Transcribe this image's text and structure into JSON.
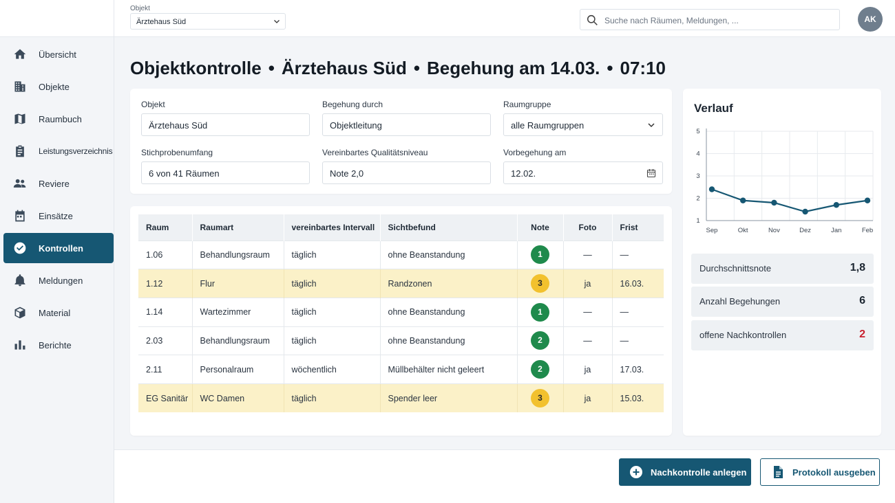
{
  "header": {
    "object_label": "Objekt",
    "object_value": "Ärztehaus Süd",
    "search_placeholder": "Suche nach Räumen, Meldungen, ...",
    "avatar_initials": "AK"
  },
  "sidebar": {
    "items": [
      {
        "label": "Übersicht",
        "icon": "home-icon"
      },
      {
        "label": "Objekte",
        "icon": "building-icon"
      },
      {
        "label": "Raumbuch",
        "icon": "map-icon"
      },
      {
        "label": "Leistungsverzeichnis",
        "icon": "clipboard-icon"
      },
      {
        "label": "Reviere",
        "icon": "people-icon"
      },
      {
        "label": "Einsätze",
        "icon": "calendar-icon"
      },
      {
        "label": "Kontrollen",
        "icon": "check-circle-icon",
        "active": true
      },
      {
        "label": "Meldungen",
        "icon": "bell-icon"
      },
      {
        "label": "Material",
        "icon": "box-icon"
      },
      {
        "label": "Berichte",
        "icon": "bar-chart-icon"
      }
    ]
  },
  "title": {
    "part1": "Objektkontrolle",
    "part2": "Ärztehaus Süd",
    "part3": "Begehung am 14.03.",
    "part4": "07:10",
    "separator": "•"
  },
  "filters": {
    "objekt": {
      "label": "Objekt",
      "value": "Ärztehaus Süd"
    },
    "begehung": {
      "label": "Begehung durch",
      "value": "Objektleitung"
    },
    "raumgruppe": {
      "label": "Raumgruppe",
      "value": "alle Raumgruppen"
    },
    "stichprobe": {
      "label": "Stichprobenumfang",
      "value": "6 von 41 Räumen"
    },
    "niveau": {
      "label": "Vereinbartes Qualitätsniveau",
      "value": "Note 2,0"
    },
    "vorbegehung": {
      "label": "Vorbegehung am",
      "value": "12.02."
    }
  },
  "table": {
    "headers": [
      "Raum",
      "Raumart",
      "vereinbartes Intervall",
      "Sichtbefund",
      "Note",
      "Foto",
      "Frist"
    ],
    "rows": [
      {
        "raum": "1.06",
        "raumart": "Behandlungsraum",
        "intervall": "täglich",
        "befund": "ohne Beanstandung",
        "note": "1",
        "foto": "—",
        "frist": "—",
        "highlight": false
      },
      {
        "raum": "1.12",
        "raumart": "Flur",
        "intervall": "täglich",
        "befund": "Randzonen",
        "note": "3",
        "foto": "ja",
        "frist": "16.03.",
        "highlight": true
      },
      {
        "raum": "1.14",
        "raumart": "Wartezimmer",
        "intervall": "täglich",
        "befund": "ohne Beanstandung",
        "note": "1",
        "foto": "—",
        "frist": "—",
        "highlight": false
      },
      {
        "raum": "2.03",
        "raumart": "Behandlungsraum",
        "intervall": "täglich",
        "befund": "ohne Beanstandung",
        "note": "2",
        "foto": "—",
        "frist": "—",
        "highlight": false
      },
      {
        "raum": "2.11",
        "raumart": "Personalraum",
        "intervall": "wöchentlich",
        "befund": "Müllbehälter nicht geleert",
        "note": "2",
        "foto": "ja",
        "frist": "17.03.",
        "highlight": false
      },
      {
        "raum": "EG Sanitär",
        "raumart": "WC Damen",
        "intervall": "täglich",
        "befund": "Spender leer",
        "note": "3",
        "foto": "ja",
        "frist": "15.03.",
        "highlight": true
      }
    ]
  },
  "verlauf": {
    "title": "Verlauf",
    "stats": [
      {
        "label": "Durchschnittsnote",
        "value": "1,8"
      },
      {
        "label": "Anzahl Begehungen",
        "value": "6"
      },
      {
        "label": "offene Nachkontrollen",
        "value": "2"
      }
    ]
  },
  "chart_data": {
    "type": "line",
    "categories": [
      "Sep",
      "Okt",
      "Nov",
      "Dez",
      "Jan",
      "Feb"
    ],
    "values": [
      2.4,
      1.9,
      1.8,
      1.4,
      1.7,
      1.9
    ],
    "y_ticks": [
      "1",
      "2",
      "3",
      "4",
      "5"
    ],
    "ylim": [
      1,
      5
    ],
    "grid": true,
    "color": "#165773"
  },
  "actions": {
    "nachkontrolle": "Nachkontrolle anlegen",
    "protokoll": "Protokoll ausgeben"
  },
  "colors": {
    "primary": "#165773",
    "highlight_row": "#fbf1c8",
    "note_good": "#1f8a4c",
    "note_warn": "#f2c12e",
    "alert": "#c8202e"
  }
}
